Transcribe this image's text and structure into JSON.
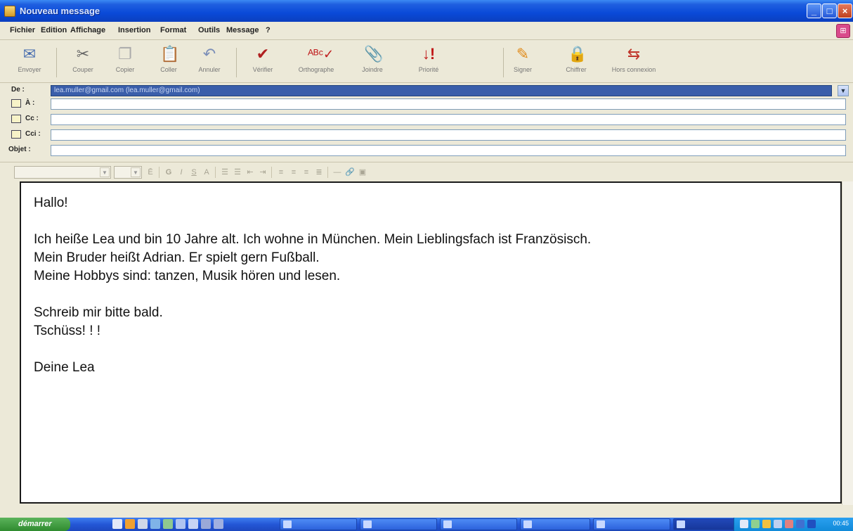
{
  "window": {
    "title": "Nouveau message"
  },
  "menu": [
    "Fichier",
    "Edition",
    "Affichage",
    "Insertion",
    "Format",
    "Outils",
    "Message",
    "?"
  ],
  "toolbar": [
    {
      "name": "send",
      "label": "Envoyer",
      "icon": "send-icon"
    },
    {
      "name": "cut",
      "label": "Couper",
      "icon": "scissors-icon"
    },
    {
      "name": "copy",
      "label": "Copier",
      "icon": "copy-icon"
    },
    {
      "name": "paste",
      "label": "Coller",
      "icon": "paste-icon"
    },
    {
      "name": "undo",
      "label": "Annuler",
      "icon": "undo-icon"
    },
    {
      "name": "check",
      "label": "Vérifier",
      "icon": "check-names-icon"
    },
    {
      "name": "spelling",
      "label": "Orthographe",
      "icon": "spelling-icon"
    },
    {
      "name": "attach",
      "label": "Joindre",
      "icon": "paperclip-icon"
    },
    {
      "name": "priority",
      "label": "Priorité",
      "icon": "priority-icon"
    },
    {
      "name": "sign",
      "label": "Signer",
      "icon": "sign-icon"
    },
    {
      "name": "encrypt",
      "label": "Chiffrer",
      "icon": "encrypt-icon"
    },
    {
      "name": "offline",
      "label": "Hors connexion",
      "icon": "offline-icon"
    }
  ],
  "headers": {
    "from_label": "De :",
    "from_value": "lea.muller@gmail.com   (lea.muller@gmail.com)",
    "to_label": "À :",
    "cc_label": "Cc :",
    "bcc_label": "Cci :",
    "subject_label": "Objet :",
    "to_value": "",
    "cc_value": "",
    "bcc_value": "",
    "subject_value": ""
  },
  "body": {
    "line1": "Hallo!",
    "line2": "Ich heiße Lea und bin 10 Jahre alt. Ich wohne in München. Mein Lieblingsfach ist Französisch.",
    "line3": "Mein Bruder heißt Adrian. Er spielt gern Fußball.",
    "line4": "Meine Hobbys sind: tanzen, Musik hören und lesen.",
    "line5": "Schreib mir bitte bald.",
    "line6": "Tschüss! ! !",
    "line7": "Deine Lea"
  },
  "taskbar": {
    "start_label": "démarrer",
    "tasks": [
      "",
      "",
      "",
      "",
      "",
      ""
    ],
    "clock": "00:45"
  },
  "colors": {
    "titlebar": "#0a4ad8",
    "taskbar": "#2457d6",
    "start": "#2f8b2f"
  }
}
